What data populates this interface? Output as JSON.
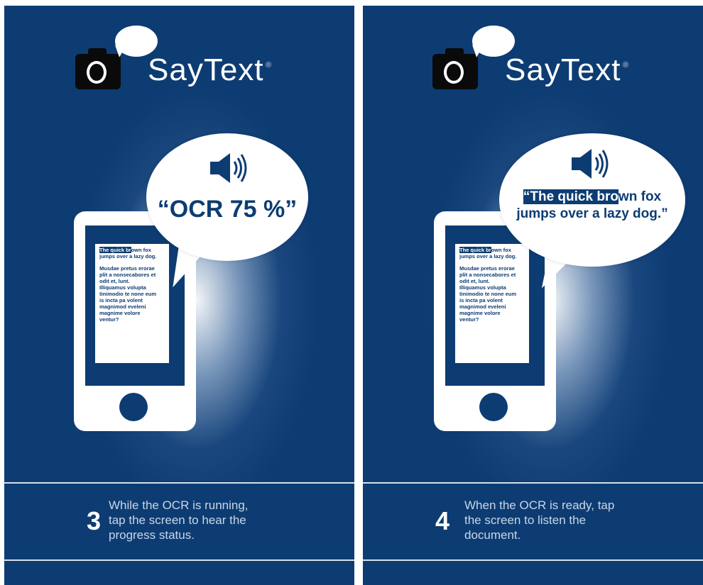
{
  "brand": {
    "name": "SayText",
    "trademark": "®"
  },
  "panels": [
    {
      "step_number": "3",
      "step_text": [
        "While the OCR is running,",
        "tap the screen to hear the",
        "progress status."
      ],
      "bubble_text": "“OCR 75 %”",
      "paper": {
        "line1_highlight": "The quick br",
        "line1_rest": "own fox",
        "line2": "jumps over a lazy dog.",
        "para": [
          "Musdae pretus erorae",
          "plit a nonsecabores et",
          "odit et, lunt.",
          "Illiquamus volupta",
          "tinimodio te none eum",
          "is incta pa volent",
          "magnimod eveleni",
          "magnime volore",
          "ventur?"
        ]
      }
    },
    {
      "step_number": "4",
      "step_text": [
        "When the OCR is ready, tap",
        "the screen to listen the",
        "document."
      ],
      "bubble_text_highlight": "“The quick bro",
      "bubble_text_rest": "wn fox",
      "bubble_text_line2": "jumps over a lazy dog.”",
      "paper": {
        "line1_highlight": "The quick br",
        "line1_rest": "own fox",
        "line2": "jumps over a lazy dog.",
        "para": [
          "Musdae pretus erorae",
          "plit a nonsecabores et",
          "odit et, lunt.",
          "Illiquamus volupta",
          "tinimodio te none eum",
          "is incta pa volent",
          "magnimod eveleni",
          "magnime volore",
          "ventur?"
        ]
      }
    }
  ],
  "colors": {
    "background": "#0d3c73",
    "text_light": "#c9d6e6",
    "white": "#ffffff"
  }
}
